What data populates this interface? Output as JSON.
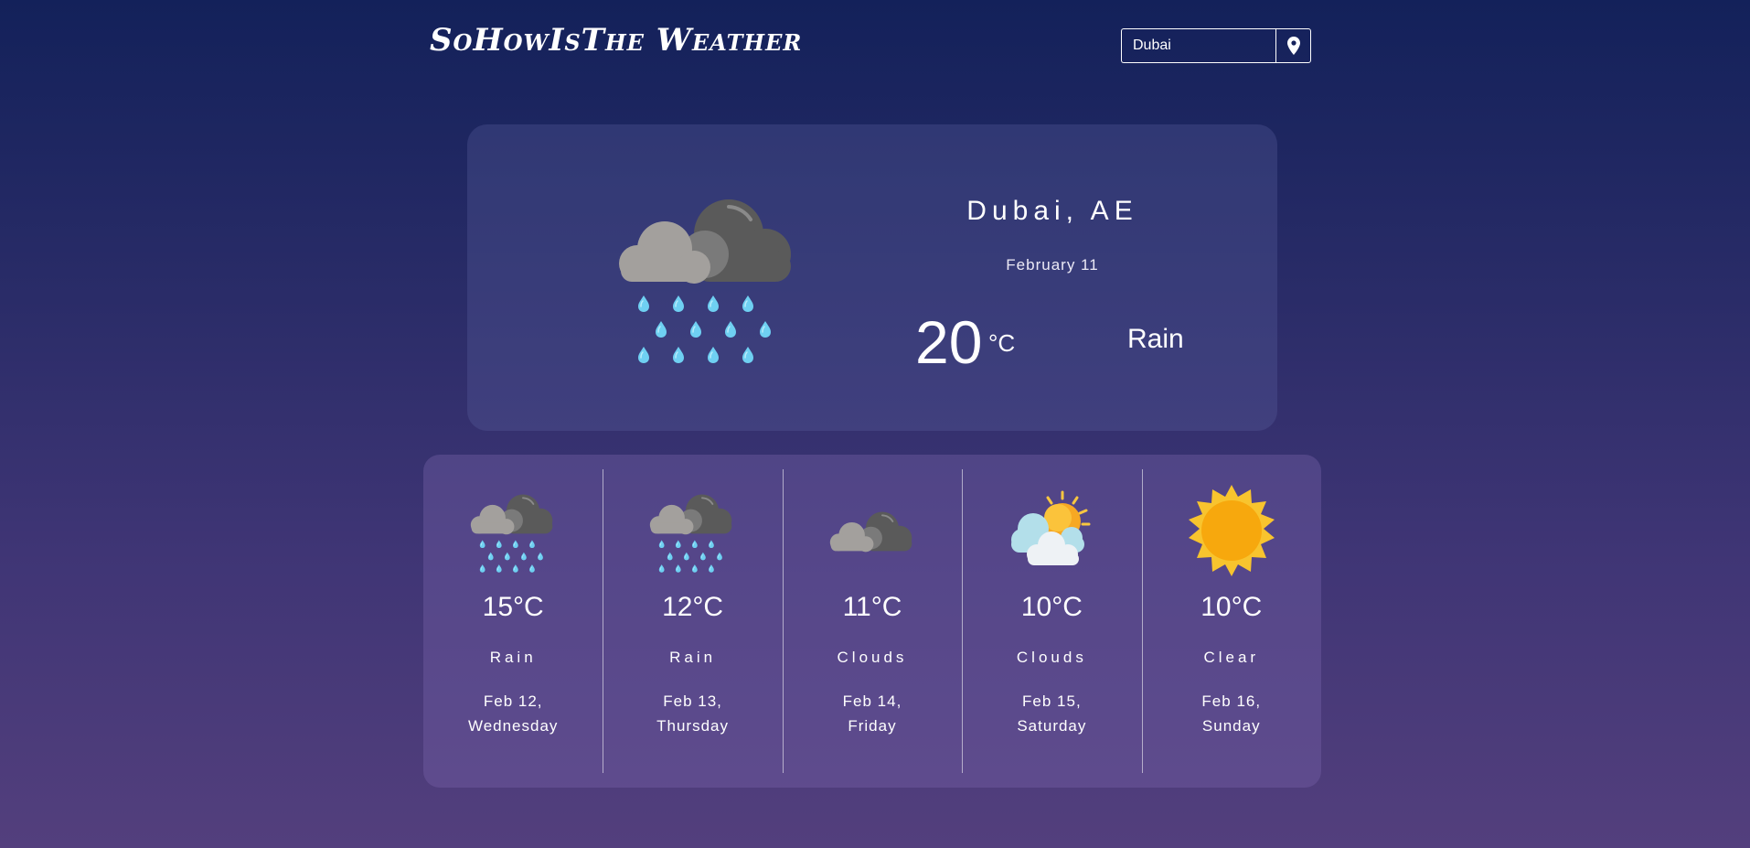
{
  "header": {
    "logo_text": "SoHowIsThe Weather"
  },
  "search": {
    "value": "Dubai",
    "placeholder": "",
    "button_icon": "map-marker-icon"
  },
  "current": {
    "city": "Dubai, AE",
    "date": "February 11",
    "temp": "20",
    "unit": "°C",
    "condition": "Rain",
    "icon": "rain-cloud-icon"
  },
  "forecast": [
    {
      "temp": "15°C",
      "condition": "Rain",
      "date_line1": "Feb 12,",
      "date_line2": "Wednesday",
      "icon": "rain-cloud-icon"
    },
    {
      "temp": "12°C",
      "condition": "Rain",
      "date_line1": "Feb 13,",
      "date_line2": "Thursday",
      "icon": "rain-cloud-icon"
    },
    {
      "temp": "11°C",
      "condition": "Clouds",
      "date_line1": "Feb 14,",
      "date_line2": "Friday",
      "icon": "dark-cloud-icon"
    },
    {
      "temp": "10°C",
      "condition": "Clouds",
      "date_line1": "Feb 15,",
      "date_line2": "Saturday",
      "icon": "sun-behind-cloud-icon"
    },
    {
      "temp": "10°C",
      "condition": "Clear",
      "date_line1": "Feb 16,",
      "date_line2": "Sunday",
      "icon": "sun-icon"
    }
  ],
  "colors": {
    "background_top": "#13215a",
    "background_bottom": "#533f7d",
    "raindrop": "#6fd0f2",
    "cloud_light": "#a3a09d",
    "cloud_dark": "#646464",
    "sun": "#f8b416"
  }
}
